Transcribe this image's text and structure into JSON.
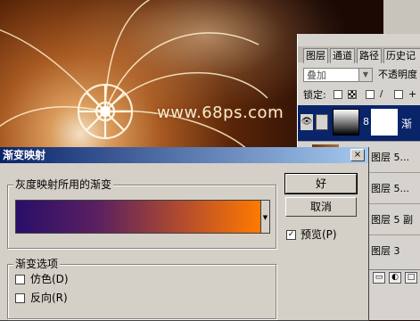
{
  "background": {
    "watermark": "www.68ps.com"
  },
  "layers_panel": {
    "tabs": [
      "图层",
      "通道",
      "路径",
      "历史记录"
    ],
    "blend_mode": "叠加",
    "opacity_label": "不透明度",
    "lock_label": "锁定:",
    "active_layer_name": "渐",
    "layers": [
      "图层 5...",
      "图层 5...",
      "图层 5 副",
      "图层 3"
    ]
  },
  "dialog": {
    "title": "渐变映射",
    "close_glyph": "×",
    "gradient_group_label": "灰度映射所用的渐变",
    "gradient_colors": [
      "#2a0e6a",
      "#5a2060",
      "#b04a30",
      "#ff7a00"
    ],
    "ok_label": "好",
    "cancel_label": "取消",
    "preview_label": "预览(P)",
    "preview_checked": true,
    "options_group_label": "渐变选项",
    "dither_label": "仿色(D)",
    "dither_checked": false,
    "reverse_label": "反向(R)",
    "reverse_checked": false
  }
}
